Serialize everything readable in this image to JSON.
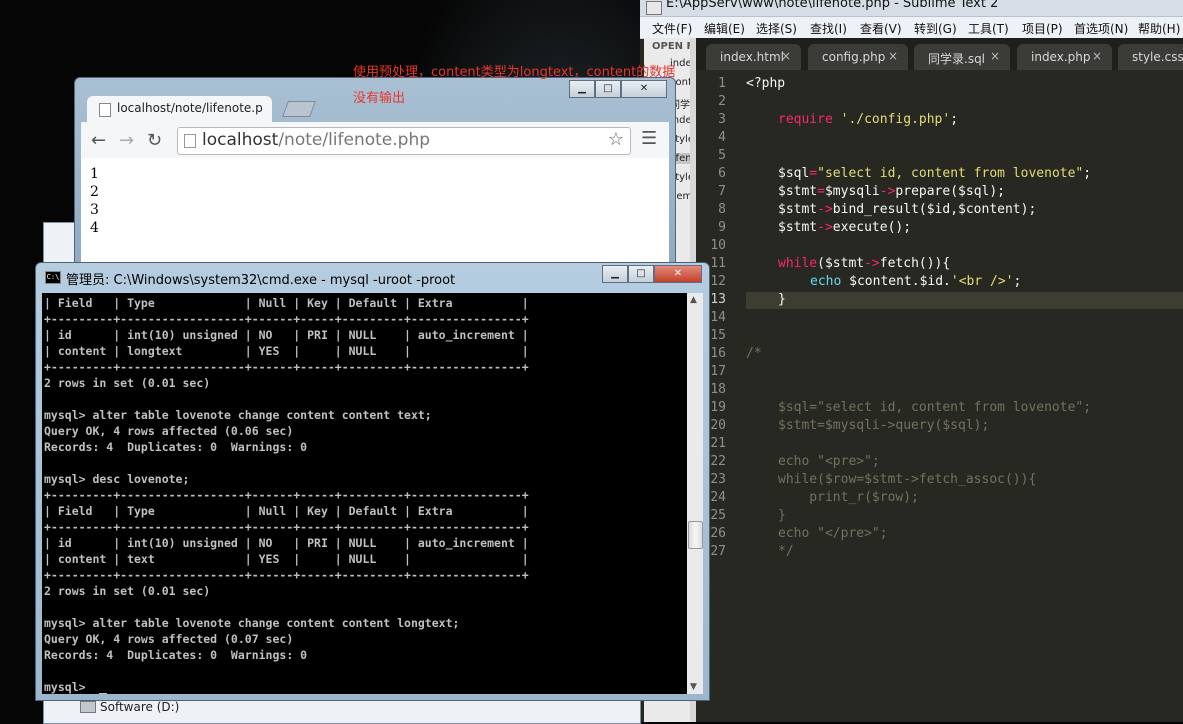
{
  "sublime": {
    "title": "E:\\AppServ\\www\\note\\lifenote.php - Sublime Text 2",
    "menu": [
      "文件(F)",
      "编辑(E)",
      "选择(S)",
      "查找(I)",
      "查看(V)",
      "转到(G)",
      "工具(T)",
      "项目(P)",
      "首选项(N)",
      "帮助(H)"
    ],
    "sidebar_header": "OPEN FI",
    "sidebar_files": [
      "index",
      "conf",
      "同学",
      "inde",
      "style",
      "lifen",
      "style",
      "demo"
    ],
    "tabs": [
      "index.html",
      "config.php",
      "同学录.sql",
      "index.php",
      "style.css –"
    ],
    "close_glyph": "×",
    "line_numbers": [
      "1",
      "2",
      "3",
      "4",
      "5",
      "6",
      "7",
      "8",
      "9",
      "10",
      "11",
      "12",
      "13",
      "14",
      "15",
      "16",
      "17",
      "18",
      "19",
      "20",
      "21",
      "22",
      "23",
      "24",
      "25",
      "26",
      "27"
    ],
    "code": {
      "l1": "<?php",
      "l3a": "require",
      "l3b": " './config.php'",
      "l3c": ";",
      "l6a": "$sql",
      "l6b": "=",
      "l6c": "\"select id, content from lovenote\"",
      "l6d": ";",
      "l7a": "$stmt",
      "l7b": "=",
      "l7c": "$mysqli",
      "l7d": "->",
      "l7e": "prepare",
      "l7f": "($sql);",
      "l8a": "$stmt",
      "l8b": "->",
      "l8c": "bind_result",
      "l8d": "($id,$content);",
      "l9a": "$stmt",
      "l9b": "->",
      "l9c": "execute",
      "l9d": "();",
      "l11a": "while",
      "l11b": "($stmt",
      "l11c": "->",
      "l11d": "fetch",
      "l11e": "()){",
      "l12a": "echo",
      "l12b": " $content.$id.",
      "l12c": "'<br />'",
      "l12d": ";",
      "l13": "}",
      "l16": "/*",
      "l19": "$sql=\"select id, content from lovenote\";",
      "l20": "$stmt=$mysqli->query($sql);",
      "l22": "echo \"<pre>\";",
      "l23": "while($row=$stmt->fetch_assoc()){",
      "l24": "    print_r($row);",
      "l25": "}",
      "l26": "echo \"</pre>\";",
      "l27": "*/"
    }
  },
  "chrome": {
    "tab_label": "localhost/note/lifenote.p",
    "url_host": "localhost",
    "url_path": "/note/lifenote.php",
    "star": "☆",
    "menu": "☰",
    "back": "←",
    "forward": "→",
    "reload": "↻",
    "output": [
      "1",
      "2",
      "3",
      "4"
    ]
  },
  "annotation": {
    "line1": "使用预处理，content类型为longtext，content的数据",
    "line2": "没有输出"
  },
  "explorer": {
    "drive": "Software (D:)"
  },
  "cmd": {
    "title": "管理员: C:\\Windows\\system32\\cmd.exe - mysql  -uroot -proot",
    "icon": "C:\\",
    "lines": [
      "| Field   | Type             | Null | Key | Default | Extra          |",
      "+---------+------------------+------+-----+---------+----------------+",
      "| id      | int(10) unsigned | NO   | PRI | NULL    | auto_increment |",
      "| content | longtext         | YES  |     | NULL    |                |",
      "+---------+------------------+------+-----+---------+----------------+",
      "2 rows in set (0.01 sec)",
      "",
      "mysql> alter table lovenote change content content text;",
      "Query OK, 4 rows affected (0.06 sec)",
      "Records: 4  Duplicates: 0  Warnings: 0",
      "",
      "mysql> desc lovenote;",
      "+---------+------------------+------+-----+---------+----------------+",
      "| Field   | Type             | Null | Key | Default | Extra          |",
      "+---------+------------------+------+-----+---------+----------------+",
      "| id      | int(10) unsigned | NO   | PRI | NULL    | auto_increment |",
      "| content | text             | YES  |     | NULL    |                |",
      "+---------+------------------+------+-----+---------+----------------+",
      "2 rows in set (0.01 sec)",
      "",
      "mysql> alter table lovenote change content content longtext;",
      "Query OK, 4 rows affected (0.07 sec)",
      "Records: 4  Duplicates: 0  Warnings: 0",
      "",
      "mysql> "
    ]
  }
}
